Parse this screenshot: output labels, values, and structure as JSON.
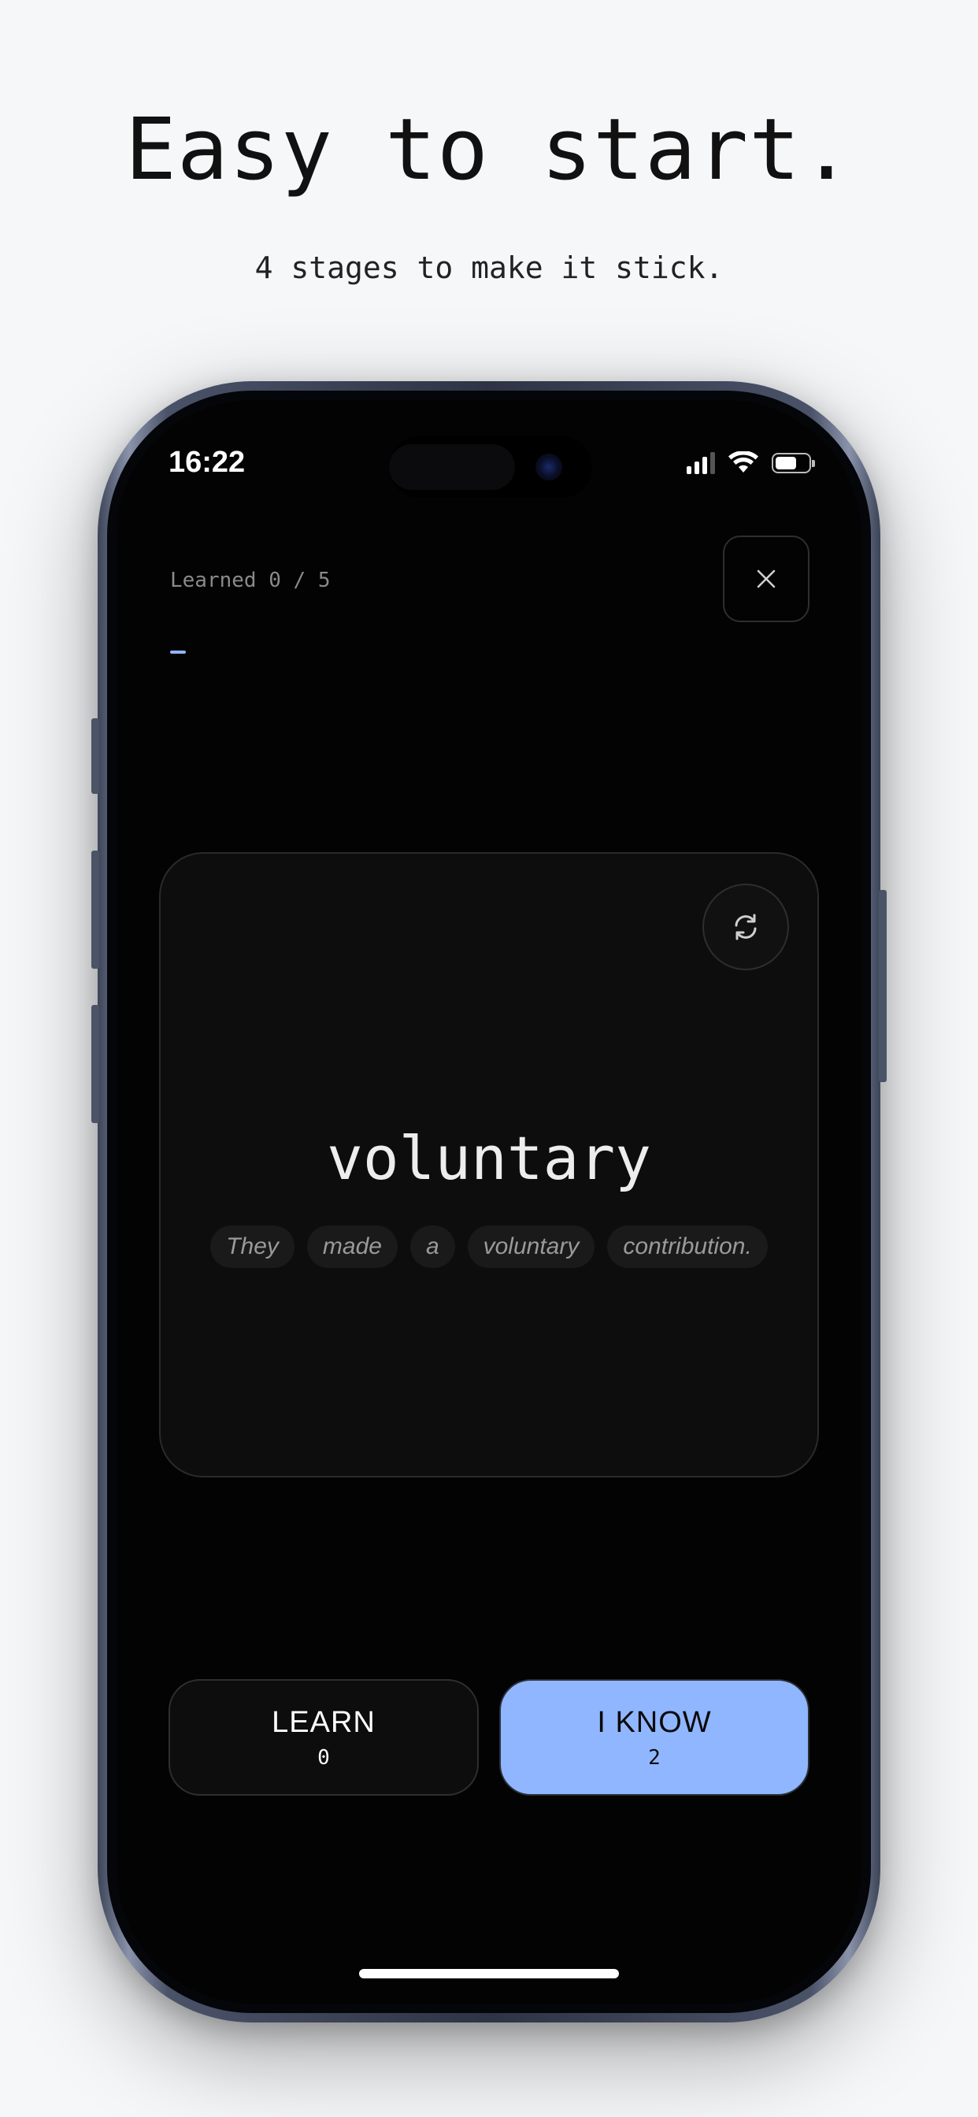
{
  "marketing": {
    "headline": "Easy to start.",
    "subline": "4 stages to make it stick."
  },
  "status_bar": {
    "time": "16:22",
    "icons": [
      "cellular-signal-icon",
      "wifi-icon",
      "battery-icon"
    ],
    "battery_level": 0.55
  },
  "session": {
    "learned_label": "Learned 0 / 5",
    "progress_fraction": 0.025,
    "close_icon": "close-icon"
  },
  "card": {
    "word": "voluntary",
    "example_words": [
      "They",
      "made",
      "a",
      "voluntary",
      "contribution."
    ],
    "flip_icon": "flip-refresh-icon"
  },
  "actions": {
    "learn": {
      "label": "LEARN",
      "count": "0"
    },
    "know": {
      "label": "I KNOW",
      "count": "2"
    }
  },
  "colors": {
    "accent": "#90b6ff",
    "background": "#030303",
    "page_background": "#f6f7f9"
  }
}
